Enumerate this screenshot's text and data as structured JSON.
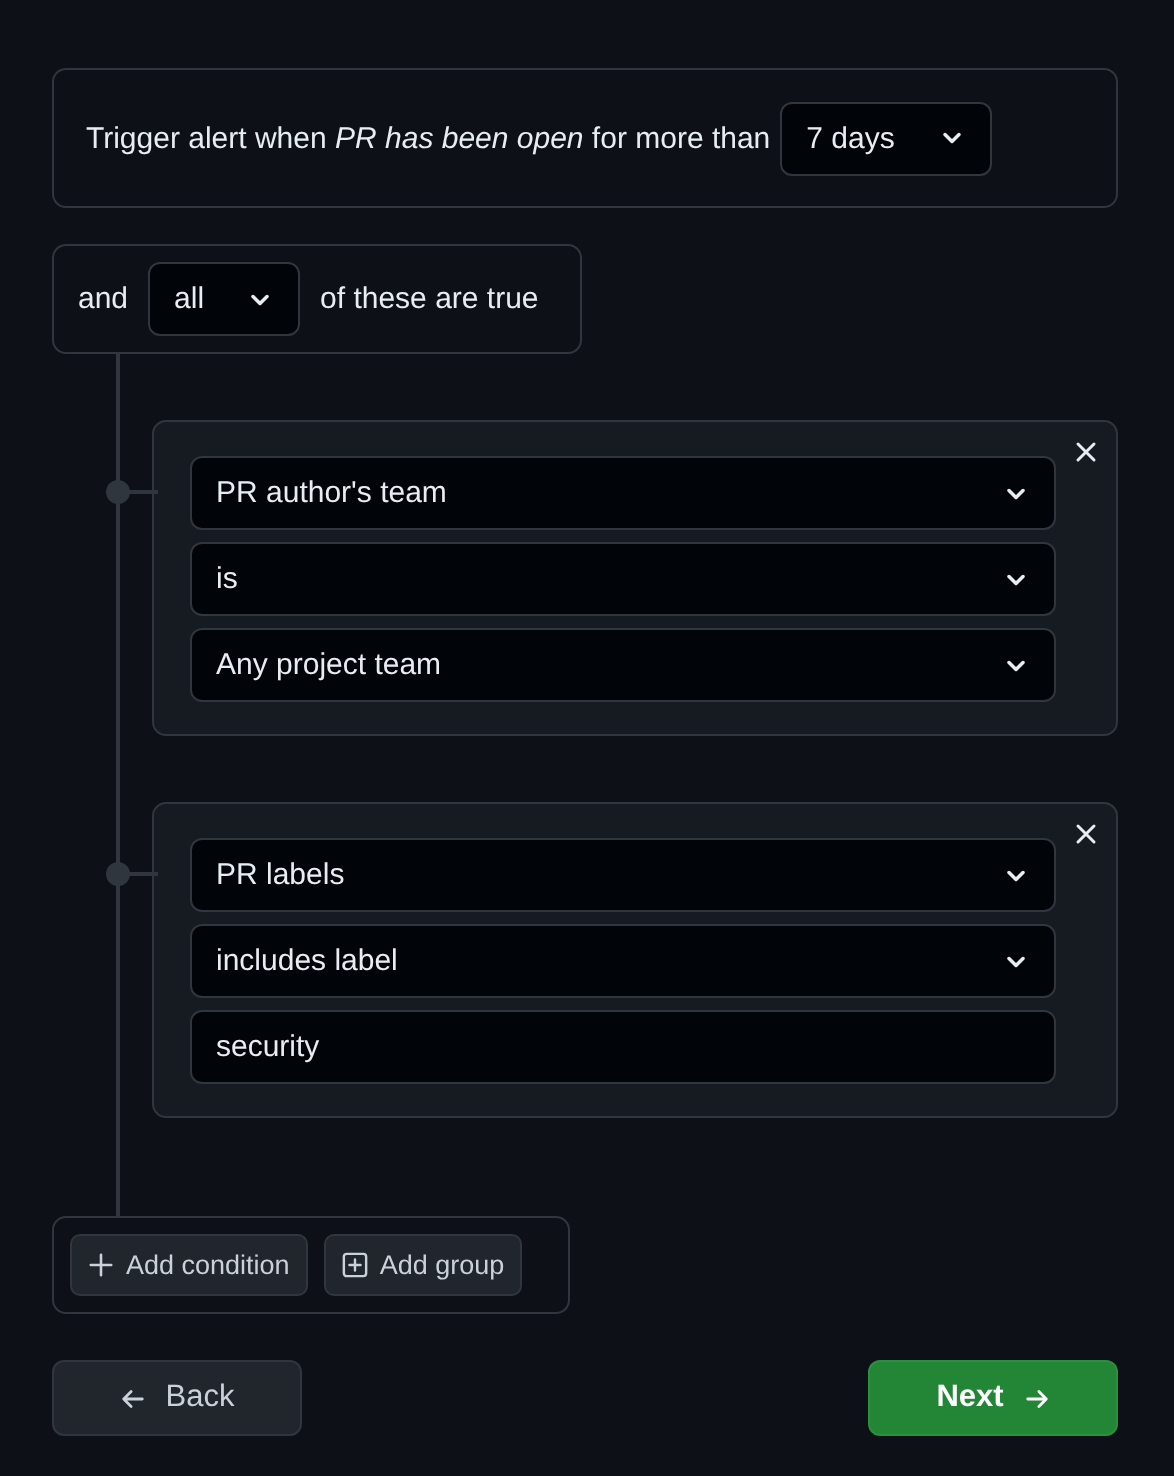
{
  "trigger": {
    "sentence": "Trigger alert when *PR has been open* for more than",
    "duration": "7 days"
  },
  "group": {
    "prefix": "and",
    "quantifier": "all",
    "suffix": "of these are true"
  },
  "conditions": [
    {
      "fields": [
        {
          "kind": "select",
          "value": "PR author's team"
        },
        {
          "kind": "select",
          "value": "is"
        },
        {
          "kind": "select",
          "value": "Any project team"
        }
      ]
    },
    {
      "fields": [
        {
          "kind": "select",
          "value": "PR labels"
        },
        {
          "kind": "select",
          "value": "includes label"
        },
        {
          "kind": "text",
          "value": "security"
        }
      ]
    }
  ],
  "add_buttons": [
    {
      "kind": "condition",
      "label": "Add condition"
    },
    {
      "kind": "group",
      "label": "Add group"
    }
  ],
  "footer": {
    "back": "Back",
    "next": "Next"
  }
}
